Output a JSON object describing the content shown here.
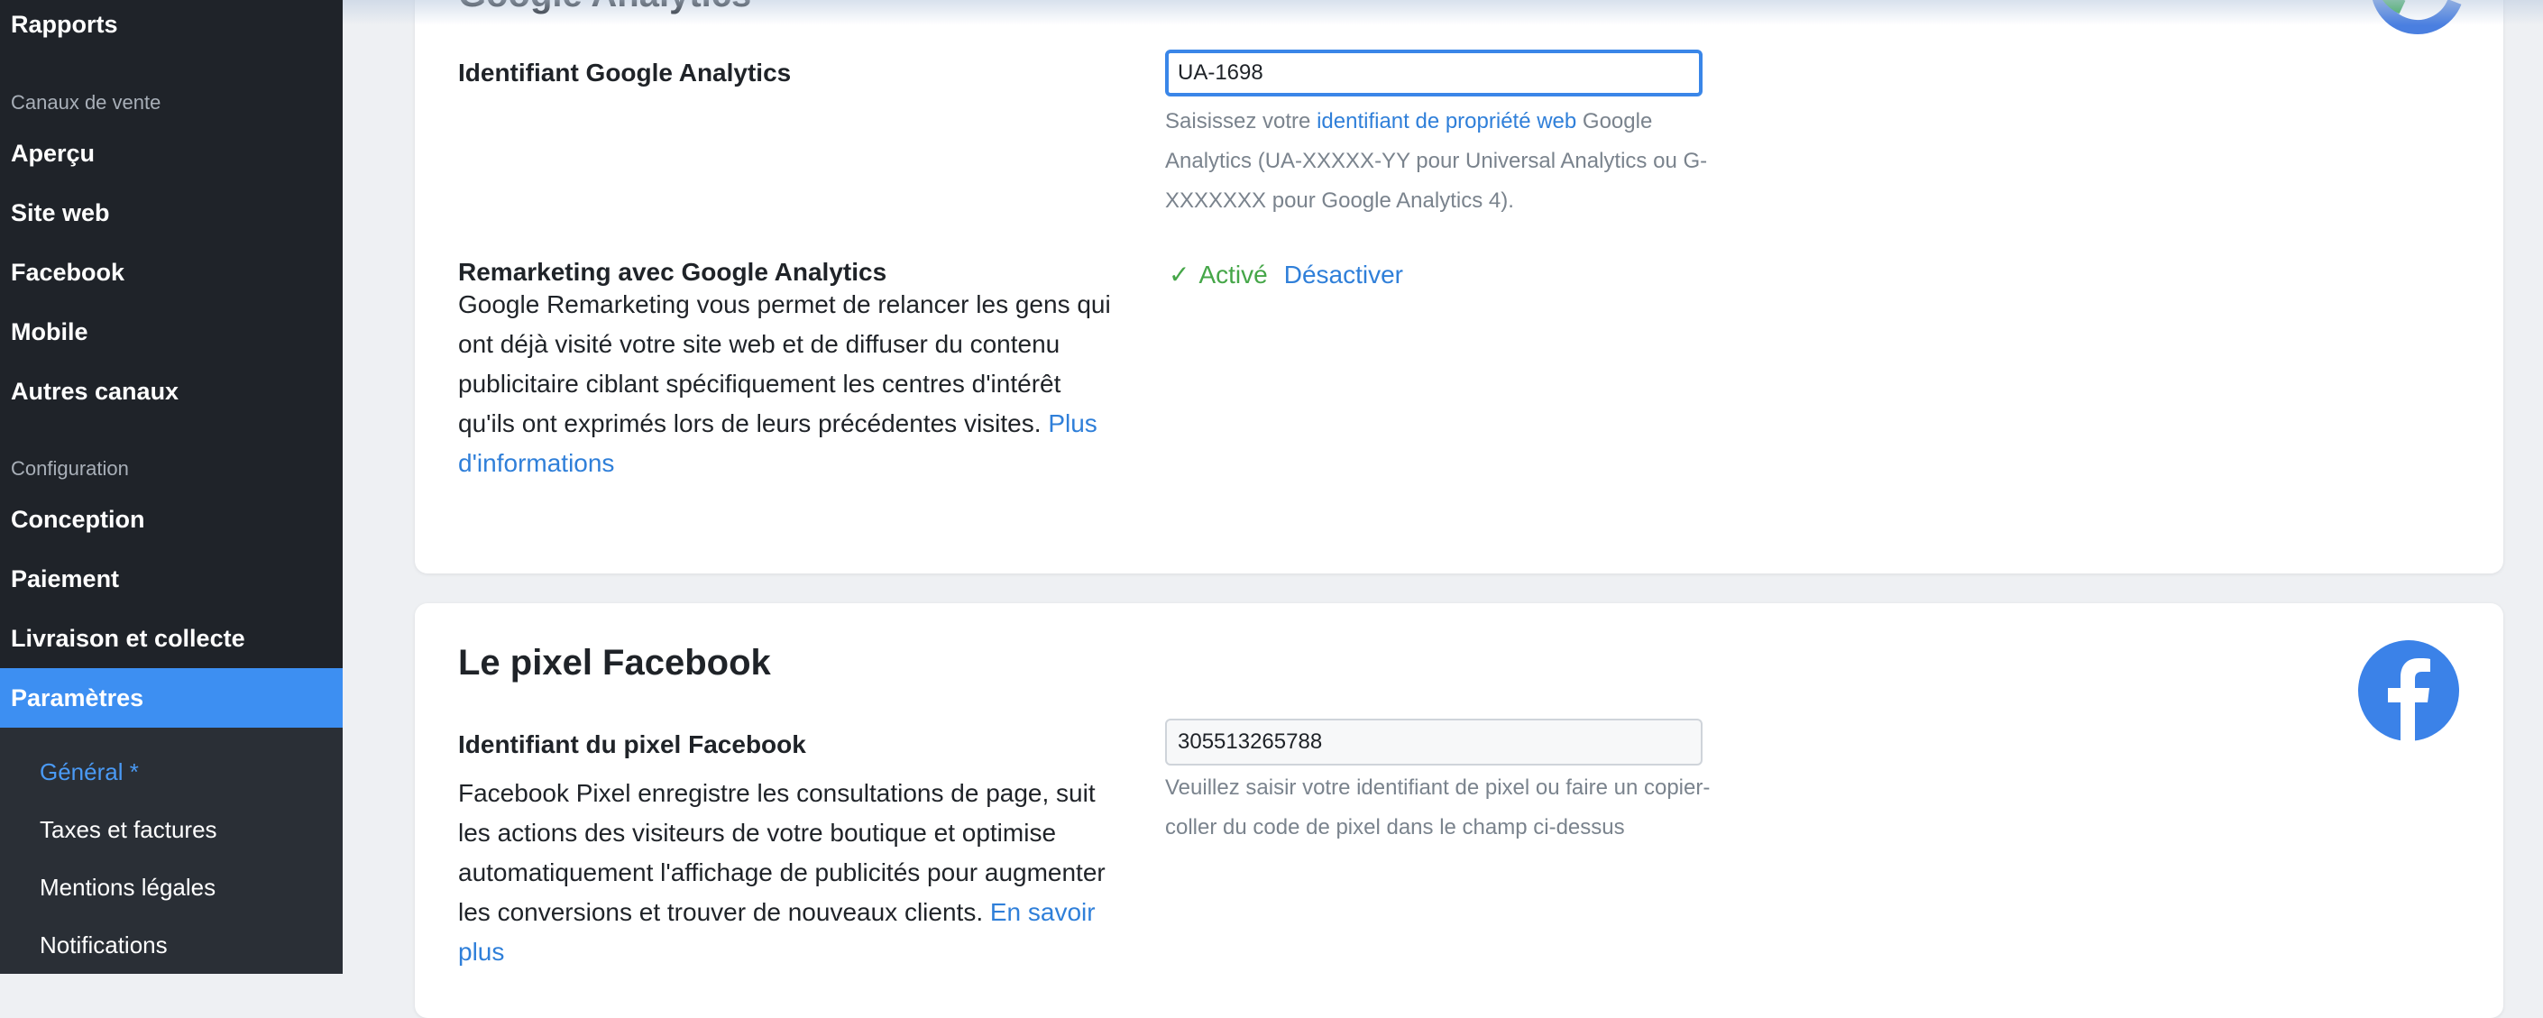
{
  "sidebar": {
    "top_item": "Rapports",
    "section_sales": "Canaux de vente",
    "sales_items": [
      "Aperçu",
      "Site web",
      "Facebook",
      "Mobile",
      "Autres canaux"
    ],
    "section_config": "Configuration",
    "config_items": [
      "Conception",
      "Paiement",
      "Livraison et collecte"
    ],
    "active_item": "Paramètres",
    "sub_items": [
      "Général *",
      "Taxes et factures",
      "Mentions légales",
      "Notifications"
    ]
  },
  "ga": {
    "title": "Google Analytics",
    "id_label": "Identifiant Google Analytics",
    "id_value": "UA-1698",
    "hint_prefix": "Saisissez votre ",
    "hint_link": "identifiant de propriété web",
    "hint_suffix": " Google Analytics (UA-XXXXX-YY pour Universal Analytics ou G-XXXXXXX pour Google Analytics 4).",
    "remarketing_label": "Remarketing avec Google Analytics",
    "remarketing_desc": "Google Remarketing vous permet de relancer les gens qui ont déjà visité votre site web et de diffuser du contenu publicitaire ciblant spécifiquement les centres d'intérêt qu'ils ont exprimés lors de leurs précédentes visites. ",
    "remarketing_link": "Plus d'informations",
    "status_check": "✓",
    "status_text": "Activé",
    "status_action": "Désactiver"
  },
  "fb": {
    "title": "Le pixel Facebook",
    "id_label": "Identifiant du pixel Facebook",
    "id_value": "305513265788",
    "desc": "Facebook Pixel enregistre les consultations de page, suit les actions des visiteurs de votre boutique et optimise automatiquement l'affichage de publicités pour augmenter les conversions et trouver de nouveaux clients. ",
    "desc_link": "En savoir plus",
    "hint": "Veuillez saisir votre identifiant de pixel ou faire un copier-coller du code de pixel dans le champ ci-dessus"
  },
  "colors": {
    "sidebar_bg": "#1f2329",
    "active_bg": "#3d8ff2",
    "link": "#2f7fd9",
    "success": "#45a648",
    "facebook": "#3b82e8"
  },
  "icons": [
    "google-logo-icon",
    "facebook-logo-icon",
    "check-icon"
  ]
}
